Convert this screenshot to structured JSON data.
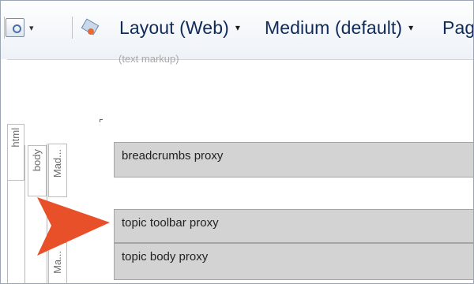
{
  "toolbar": {
    "layout_label": "Layout (Web)",
    "medium_label": "Medium (default)",
    "page_label": "Pag",
    "dropdown_arrow": "▾"
  },
  "editor": {
    "hint": "(text markup)",
    "structure": {
      "html_label": "html",
      "body_label": "body",
      "mad_label": "Mad...",
      "ma_label": "Ma..."
    },
    "proxies": [
      {
        "label": "breadcrumbs proxy"
      },
      {
        "label": "topic toolbar proxy"
      },
      {
        "label": "topic body proxy"
      }
    ]
  },
  "colors": {
    "proxy_fill": "#d3d3d3",
    "callout_arrow": "#e8502a",
    "toolbar_text": "#102a59"
  },
  "icons": [
    "view-icon",
    "tag-icon",
    "callout-arrow-icon"
  ]
}
